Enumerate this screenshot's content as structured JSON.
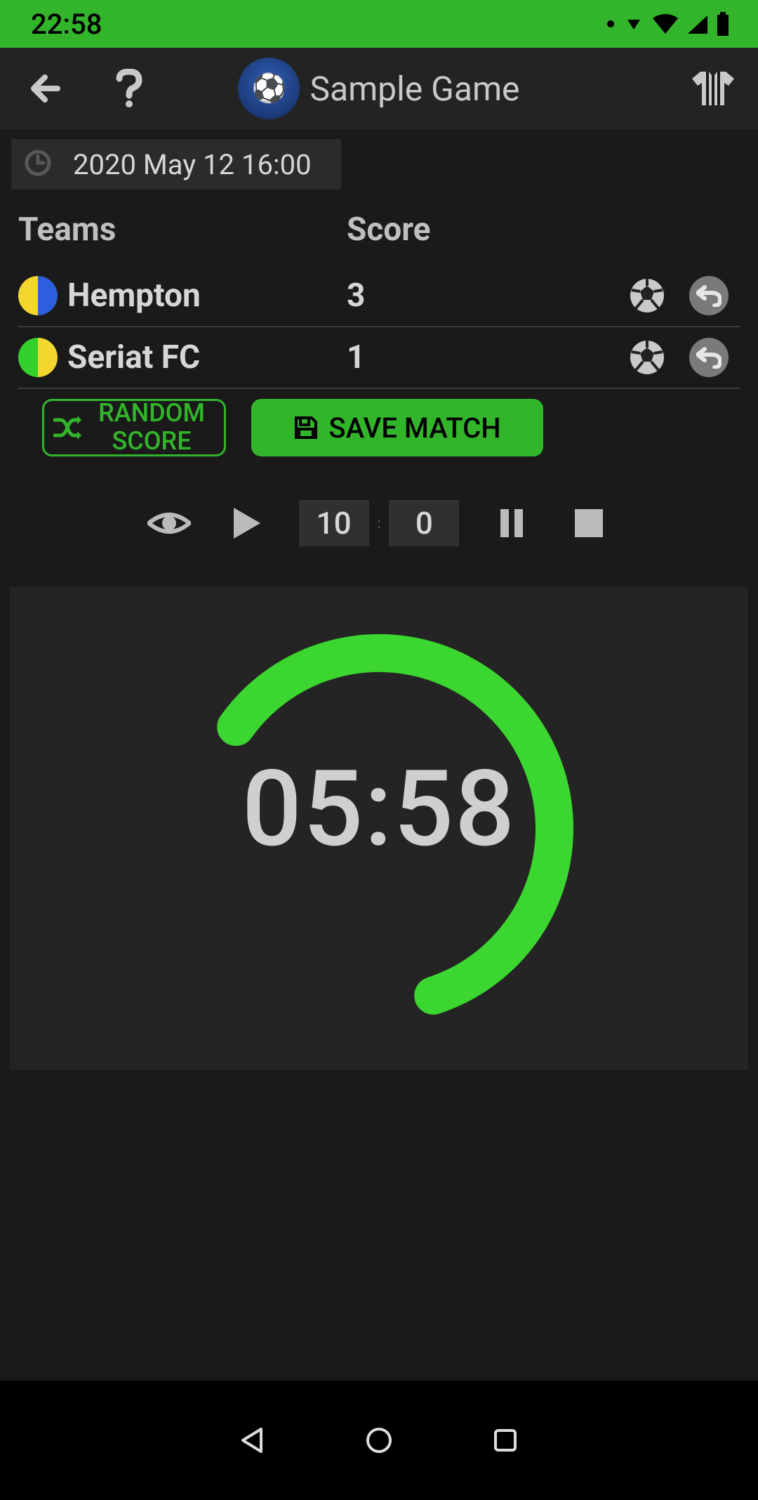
{
  "status": {
    "time": "22:58"
  },
  "header": {
    "title": "Sample Game"
  },
  "date_chip": {
    "text": "2020 May 12 16:00"
  },
  "table": {
    "header_teams": "Teams",
    "header_score": "Score",
    "rows": [
      {
        "name": "Hempton",
        "score": "3",
        "colors": [
          "#f3d72e",
          "#2c5fdd"
        ]
      },
      {
        "name": "Seriat FC",
        "score": "1",
        "colors": [
          "#35cf2e",
          "#f3d72e"
        ]
      }
    ]
  },
  "buttons": {
    "random_score": "RANDOM SCORE",
    "save_match": "SAVE MATCH"
  },
  "controls": {
    "minutes": "10",
    "seconds": "0"
  },
  "timer": {
    "display": "05:58"
  }
}
